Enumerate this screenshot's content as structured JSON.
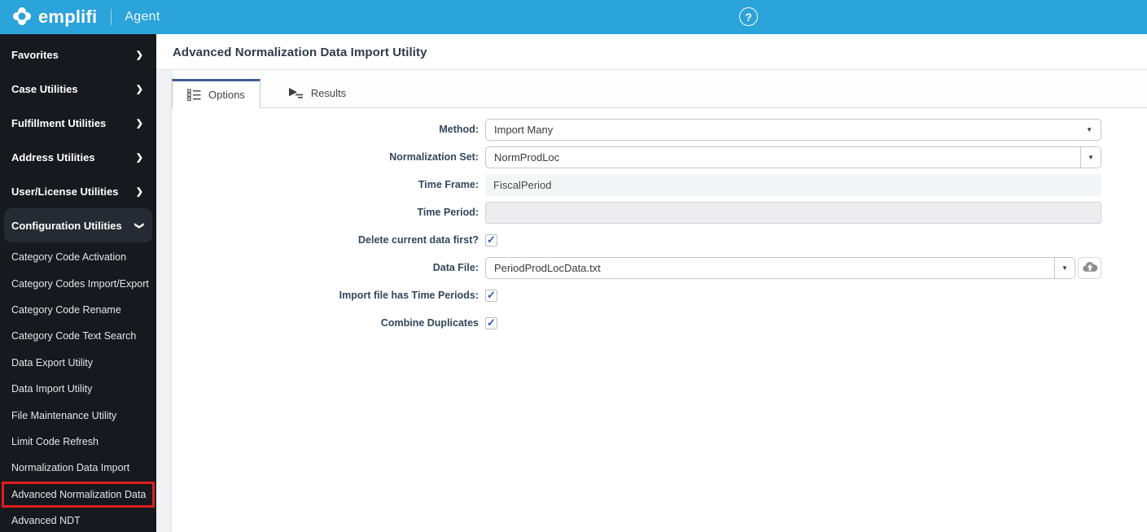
{
  "page": {
    "title": "Advanced Normalization Data Import Utility"
  },
  "header": {
    "brand": "emplifi",
    "product": "Agent"
  },
  "icons": {
    "help": "?",
    "chevron_right": "❯",
    "caret_down": "▼",
    "check": "✓"
  },
  "colors": {
    "header_bg": "#2BA3DB",
    "sidebar_bg": "#16191E",
    "sidebar_active_bg": "#262B33",
    "tab_accent": "#3D6191",
    "highlight_red": "#E01F1F",
    "check_blue": "#2B57C8"
  },
  "sidebar": {
    "sections": [
      {
        "label": "Favorites",
        "expanded": false
      },
      {
        "label": "Case Utilities",
        "expanded": false
      },
      {
        "label": "Fulfillment Utilities",
        "expanded": false
      },
      {
        "label": "Address Utilities",
        "expanded": false
      },
      {
        "label": "User/License Utilities",
        "expanded": false
      },
      {
        "label": "Configuration Utilities",
        "expanded": true
      }
    ],
    "items": [
      {
        "label": "Category Code Activation"
      },
      {
        "label": "Category Codes Import/Export"
      },
      {
        "label": "Category Code Rename"
      },
      {
        "label": "Category Code Text Search"
      },
      {
        "label": "Data Export Utility"
      },
      {
        "label": "Data Import Utility"
      },
      {
        "label": "File Maintenance Utility"
      },
      {
        "label": "Limit Code Refresh"
      },
      {
        "label": "Normalization Data Import"
      },
      {
        "label": "Advanced Normalization Data",
        "highlighted": true
      },
      {
        "label": "Advanced NDT"
      }
    ]
  },
  "tabs": [
    {
      "label": "Options",
      "active": true
    },
    {
      "label": "Results",
      "active": false
    }
  ],
  "form": {
    "rows": [
      {
        "label": "Method:",
        "type": "select",
        "value": "Import Many"
      },
      {
        "label": "Normalization Set:",
        "type": "combobox",
        "value": "NormProdLoc"
      },
      {
        "label": "Time Frame:",
        "type": "readonly",
        "value": "FiscalPeriod"
      },
      {
        "label": "Time Period:",
        "type": "disabled",
        "value": ""
      },
      {
        "label": "Delete current data first?",
        "type": "checkbox",
        "checked": true
      },
      {
        "label": "Data File:",
        "type": "file-combobox",
        "value": "PeriodProdLocData.txt"
      },
      {
        "label": "Import file has Time Periods:",
        "type": "checkbox",
        "checked": true
      },
      {
        "label": "Combine Duplicates",
        "type": "checkbox",
        "checked": true
      }
    ]
  }
}
